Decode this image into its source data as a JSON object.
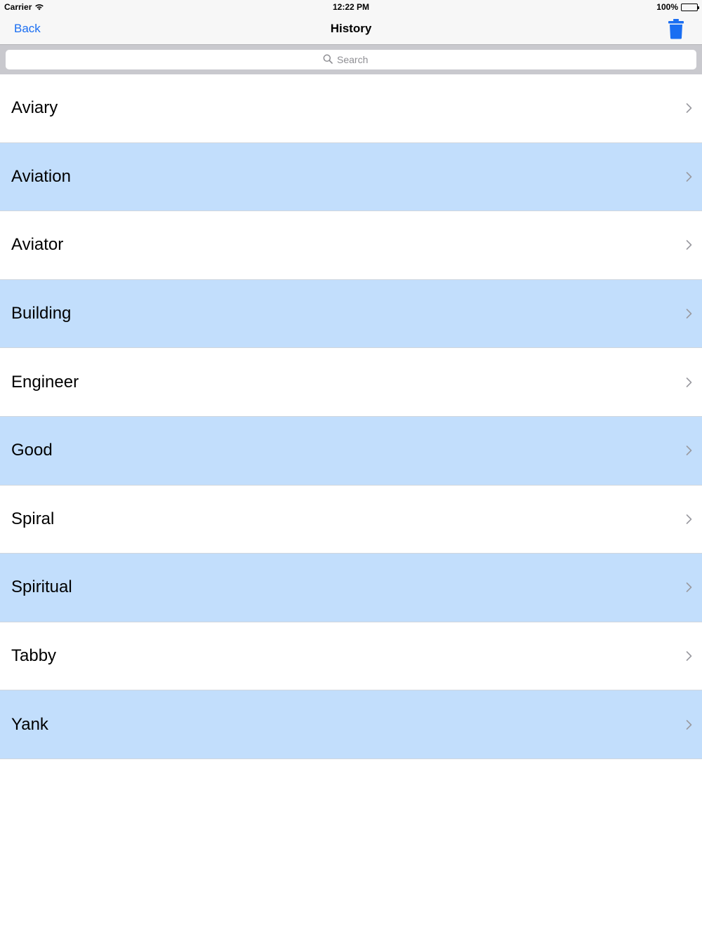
{
  "status_bar": {
    "carrier": "Carrier",
    "time": "12:22 PM",
    "battery": "100%",
    "wifi_icon": "wifi-icon",
    "battery_icon": "battery-icon"
  },
  "nav": {
    "back_label": "Back",
    "title": "History",
    "trash_icon": "trash-icon",
    "accent_color": "#1a6ef2"
  },
  "search": {
    "placeholder": "Search",
    "value": "",
    "icon": "search-icon"
  },
  "colors": {
    "alt_row": "#c2defc",
    "row": "#ffffff"
  },
  "history": {
    "items": [
      {
        "label": "Aviary"
      },
      {
        "label": "Aviation"
      },
      {
        "label": "Aviator"
      },
      {
        "label": "Building"
      },
      {
        "label": "Engineer"
      },
      {
        "label": "Good"
      },
      {
        "label": "Spiral"
      },
      {
        "label": "Spiritual"
      },
      {
        "label": "Tabby"
      },
      {
        "label": "Yank"
      }
    ]
  }
}
